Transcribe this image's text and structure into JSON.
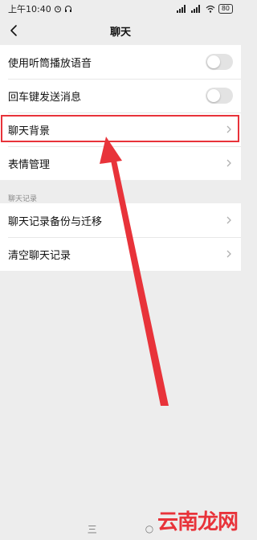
{
  "status_bar": {
    "time": "上午10:40",
    "battery": "80"
  },
  "nav": {
    "title": "聊天"
  },
  "settings": [
    {
      "label": "使用听筒播放语音",
      "control": "toggle",
      "on": false
    },
    {
      "label": "回车键发送消息",
      "control": "toggle",
      "on": false
    },
    {
      "label": "聊天背景",
      "control": "chevron"
    },
    {
      "label": "表情管理",
      "control": "chevron"
    }
  ],
  "history_section": {
    "header": "聊天记录",
    "items": [
      {
        "label": "聊天记录备份与迁移"
      },
      {
        "label": "清空聊天记录"
      }
    ]
  },
  "colors": {
    "highlight": "#e8333a",
    "arrow": "#e8333a",
    "background": "#ededed"
  },
  "watermark": "云南龙网",
  "system_nav": {
    "menu": "三",
    "home": "○"
  }
}
